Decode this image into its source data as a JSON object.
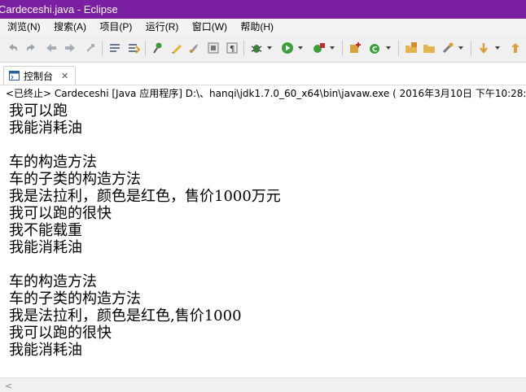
{
  "window": {
    "title": "Cardeceshi.java - Eclipse"
  },
  "menu": [
    "浏览(N)",
    "搜索(A)",
    "项目(P)",
    "运行(R)",
    "窗口(W)",
    "帮助(H)"
  ],
  "view_tab": {
    "label": "控制台",
    "close": "✕"
  },
  "console": {
    "status": "<已终止> Cardeceshi [Java 应用程序] D:\\、hanqi\\jdk1.7.0_60_x64\\bin\\javaw.exe ( 2016年3月10日 下午10:28:21 )",
    "lines": [
      "我可以跑",
      "我能消耗油",
      "",
      "车的构造方法",
      "车的子类的构造方法",
      "我是法拉利，颜色是红色，售价1000万元",
      "我可以跑的很快",
      "我不能载重",
      "我能消耗油",
      "",
      "车的构造方法",
      "车的子类的构造方法",
      "我是法拉利，颜色是红色,售价1000",
      "我可以跑的很快",
      "我能消耗油"
    ]
  },
  "scrollbar": {
    "left_arrow": "<"
  },
  "colors": {
    "title_bar": "#7a1fa2",
    "menu_bg": "#f3f3f3",
    "toolbar_bg": "#f0f0f0",
    "console_text": "#000000"
  },
  "toolbar_icons": [
    "undo-icon",
    "redo-icon",
    "back-icon",
    "forward-icon",
    "last-edit-icon",
    "toggle-mark-icon",
    "next-annotation-icon",
    "pin-icon",
    "pen-icon",
    "brush-icon",
    "show-whitespace-icon",
    "paragraph-icon",
    "debug-icon",
    "run-icon",
    "run-external-icon",
    "new-class-icon",
    "new-package-icon",
    "open-type-icon",
    "open-folder-icon",
    "search-icon",
    "navigate-icon",
    "up-icon"
  ]
}
